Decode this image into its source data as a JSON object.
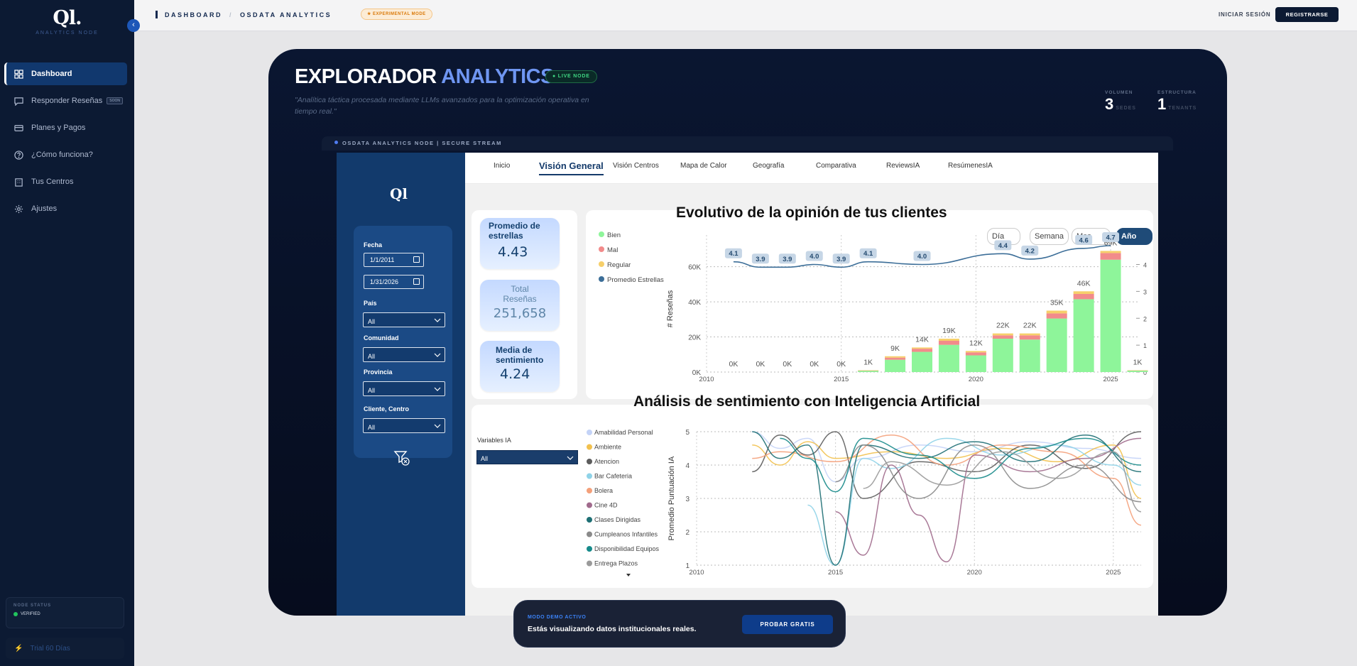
{
  "sidebar": {
    "logo_mark": "Ql.",
    "logo_sub": "ANALYTICS NODE",
    "collapse_icon": "chevron-left-icon",
    "items": [
      {
        "label": "Dashboard",
        "icon": "dashboard-icon",
        "active": true
      },
      {
        "label": "Responder Reseñas",
        "icon": "message-icon",
        "badge": "SOON"
      },
      {
        "label": "Planes y Pagos",
        "icon": "card-icon"
      },
      {
        "label": "¿Cómo funciona?",
        "icon": "help-icon"
      },
      {
        "label": "Tus Centros",
        "icon": "building-icon"
      },
      {
        "label": "Ajustes",
        "icon": "gear-icon"
      }
    ],
    "node_status": {
      "title": "NODE STATUS",
      "value": "VERIFIED"
    },
    "trial": "Trial 60 Días"
  },
  "topbar": {
    "crumb_1": "DASHBOARD",
    "crumb_sep": "/",
    "crumb_2": "OSDATA ANALYTICS",
    "experimental": "★ EXPERIMENTAL MODE",
    "login": "INICIAR SESIÓN",
    "register": "REGISTRARSE"
  },
  "hero": {
    "title_a": "EXPLORADOR",
    "title_b": "ANALYTICS",
    "live": "● LIVE NODE",
    "subtitle": "\"Analítica táctica procesada mediante LLMs avanzados para la optimización operativa en tiempo real.\"",
    "stats": [
      {
        "label": "VOLUMEN",
        "value": "3",
        "unit": "SEDES"
      },
      {
        "label": "ESTRUCTURA",
        "value": "1",
        "unit": "TENANTS"
      }
    ],
    "stream": "OSDATA ANALYTICS NODE | SECURE STREAM"
  },
  "report": {
    "logo": "Ql",
    "tabs": [
      "Inicio",
      "Visión General",
      "Visión Centros",
      "Mapa de Calor",
      "Geografía",
      "Comparativa",
      "ReviewsIA",
      "ResúmenesIA"
    ],
    "active_tab": "Visión General",
    "filters": {
      "fecha_label": "Fecha",
      "date_from": "1/1/2011",
      "date_to": "1/31/2026",
      "pais_label": "País",
      "pais_value": "All",
      "comunidad_label": "Comunidad",
      "comunidad_value": "All",
      "provincia_label": "Provincia",
      "provincia_value": "All",
      "cliente_label": "Cliente, Centro",
      "cliente_value": "All",
      "reset_icon": "filter-clear-icon"
    },
    "kpis": [
      {
        "label": "Promedio de estrellas",
        "value": "4.43"
      },
      {
        "label": "Total Reseñas",
        "value": "251,658"
      },
      {
        "label": "Media de sentimiento",
        "value": "4.24"
      }
    ],
    "granularity": [
      "Día",
      "Semana",
      "Mes",
      "Año"
    ],
    "granularity_selected": "Año",
    "chart1_title": "Evolutivo de la opinión de tus clientes",
    "chart2_title": "Análisis de sentimiento con Inteligencia Artificial",
    "variables_label": "Variables IA",
    "variables_value": "All"
  },
  "chart_data": [
    {
      "type": "bar",
      "title": "Evolutivo de la opinión de tus clientes",
      "ylabel": "# Reseñas",
      "xlabel": "",
      "legend": [
        "Bien",
        "Mal",
        "Regular",
        "Promedio Estrellas"
      ],
      "legend_position": "left",
      "colors": {
        "Bien": "#8ef59a",
        "Mal": "#f28b8b",
        "Regular": "#f6cf6a",
        "Promedio Estrellas": "#3c6e98"
      },
      "categories": [
        2011,
        2012,
        2013,
        2014,
        2015,
        2016,
        2017,
        2018,
        2019,
        2020,
        2021,
        2022,
        2023,
        2024,
        2025,
        2026
      ],
      "x_ticks": [
        2010,
        2015,
        2020,
        2025
      ],
      "y_ticks": [
        "0K",
        "20K",
        "40K",
        "60K"
      ],
      "y2_ticks": [
        "0",
        "1",
        "2",
        "3",
        "4"
      ],
      "ylim": [
        0,
        72000
      ],
      "y2lim": [
        0,
        4.7
      ],
      "series": [
        {
          "name": "Bien",
          "values": [
            0,
            0,
            0,
            0,
            0,
            800,
            7000,
            11500,
            15500,
            9500,
            19000,
            18500,
            30500,
            41500,
            64000,
            900
          ]
        },
        {
          "name": "Mal",
          "values": [
            0,
            0,
            0,
            0,
            0,
            100,
            1200,
            1800,
            2300,
            1700,
            1900,
            2400,
            2900,
            3000,
            3800,
            50
          ]
        },
        {
          "name": "Regular",
          "values": [
            0,
            0,
            0,
            0,
            0,
            100,
            800,
            700,
            1200,
            800,
            1100,
            1100,
            1600,
            1500,
            1200,
            50
          ]
        },
        {
          "name": "Promedio Estrellas",
          "axis": "secondary",
          "values": [
            4.1,
            3.9,
            3.9,
            4.0,
            3.9,
            4.1,
            null,
            4.0,
            null,
            null,
            4.4,
            4.2,
            null,
            4.6,
            4.7,
            null
          ]
        }
      ],
      "bar_labels": [
        "0K",
        "0K",
        "0K",
        "0K",
        "0K",
        "1K",
        "9K",
        "14K",
        "19K",
        "12K",
        "22K",
        "22K",
        "35K",
        "46K",
        "69K",
        "1K"
      ],
      "line_labels": [
        "4.1",
        "3.9",
        "3.9",
        "4.0",
        "3.9",
        "4.1",
        "",
        "4.0",
        "",
        "",
        "4.4",
        "4.2",
        "",
        "4.6",
        "4.7",
        ""
      ]
    },
    {
      "type": "line",
      "title": "Análisis de sentimiento con Inteligencia Artificial",
      "ylabel": "Promedio Puntuación IA",
      "xlabel": "",
      "x_ticks": [
        2010,
        2015,
        2020,
        2025
      ],
      "y_ticks": [
        1,
        2,
        3,
        4,
        5
      ],
      "ylim": [
        1,
        5
      ],
      "xlim": [
        2010,
        2026
      ],
      "legend": [
        {
          "name": "Amabilidad Personal",
          "color": "#c4d3f7"
        },
        {
          "name": "Ambiente",
          "color": "#f2c14e"
        },
        {
          "name": "Atencion",
          "color": "#5c5c5c"
        },
        {
          "name": "Bar Cafeteria",
          "color": "#8fd3e8"
        },
        {
          "name": "Bolera",
          "color": "#f4a07a"
        },
        {
          "name": "Cine 4D",
          "color": "#a06a8c"
        },
        {
          "name": "Clases Dirigidas",
          "color": "#1e6f74"
        },
        {
          "name": "Cumpleanos Infantiles",
          "color": "#8a8a8a"
        },
        {
          "name": "Disponibilidad Equipos",
          "color": "#178a8a"
        },
        {
          "name": "Entrega Plazos",
          "color": "#9a9a9a"
        }
      ],
      "series": [
        {
          "name": "Amabilidad Personal",
          "values": [
            [
              2012,
              5
            ],
            [
              2013,
              4.5
            ],
            [
              2014,
              4.8
            ],
            [
              2015,
              3.5
            ],
            [
              2016,
              4.2
            ],
            [
              2018,
              4.6
            ],
            [
              2020,
              4.4
            ],
            [
              2022,
              4.7
            ],
            [
              2024,
              4.5
            ],
            [
              2026,
              4.2
            ]
          ]
        },
        {
          "name": "Ambiente",
          "values": [
            [
              2012,
              4.6
            ],
            [
              2013,
              4.0
            ],
            [
              2014,
              4.7
            ],
            [
              2015,
              4.2
            ],
            [
              2017,
              4.4
            ],
            [
              2019,
              4.2
            ],
            [
              2021,
              4.5
            ],
            [
              2023,
              4.1
            ],
            [
              2025,
              4.6
            ],
            [
              2026,
              3.0
            ]
          ]
        },
        {
          "name": "Atencion",
          "values": [
            [
              2012,
              3.8
            ],
            [
              2013,
              4.9
            ],
            [
              2014,
              4.3
            ],
            [
              2015,
              5
            ],
            [
              2016,
              3.0
            ],
            [
              2018,
              4.1
            ],
            [
              2020,
              3.8
            ],
            [
              2022,
              4.6
            ],
            [
              2024,
              3.9
            ],
            [
              2026,
              5
            ]
          ]
        },
        {
          "name": "Bar Cafeteria",
          "values": [
            [
              2014,
              2.8
            ],
            [
              2015,
              1.0
            ],
            [
              2016,
              4.2
            ],
            [
              2017,
              3.9
            ],
            [
              2019,
              4.8
            ],
            [
              2021,
              4.3
            ],
            [
              2023,
              4.6
            ],
            [
              2025,
              4.0
            ],
            [
              2026,
              3.4
            ]
          ]
        },
        {
          "name": "Bolera",
          "values": [
            [
              2012,
              4.2
            ],
            [
              2013,
              4.4
            ],
            [
              2015,
              4.1
            ],
            [
              2017,
              4.9
            ],
            [
              2019,
              4.0
            ],
            [
              2021,
              4.6
            ],
            [
              2023,
              4.4
            ],
            [
              2025,
              3.6
            ],
            [
              2026,
              2.2
            ]
          ]
        },
        {
          "name": "Cine 4D",
          "values": [
            [
              2015,
              2.6
            ],
            [
              2016,
              1.3
            ],
            [
              2017,
              4.0
            ],
            [
              2018,
              2.5
            ],
            [
              2019,
              1.1
            ],
            [
              2020,
              4.3
            ],
            [
              2022,
              3.8
            ],
            [
              2024,
              4.2
            ],
            [
              2026,
              4.8
            ]
          ]
        },
        {
          "name": "Clases Dirigidas",
          "values": [
            [
              2012,
              5
            ],
            [
              2013,
              4.2
            ],
            [
              2014,
              4.6
            ],
            [
              2015,
              1.0
            ],
            [
              2016,
              4.6
            ],
            [
              2018,
              4.2
            ],
            [
              2020,
              4.7
            ],
            [
              2022,
              4.1
            ],
            [
              2024,
              4.9
            ],
            [
              2026,
              3.8
            ]
          ]
        },
        {
          "name": "Cumpleanos Infantiles",
          "values": [
            [
              2015,
              3.5
            ],
            [
              2016,
              4.6
            ],
            [
              2018,
              3.0
            ],
            [
              2020,
              4.6
            ],
            [
              2022,
              3.3
            ],
            [
              2024,
              4.0
            ],
            [
              2026,
              2.9
            ]
          ]
        },
        {
          "name": "Disponibilidad Equipos",
          "values": [
            [
              2013,
              4.8
            ],
            [
              2014,
              4.2
            ],
            [
              2015,
              3.2
            ],
            [
              2016,
              4.8
            ],
            [
              2018,
              4.3
            ],
            [
              2020,
              3.6
            ],
            [
              2022,
              4.5
            ],
            [
              2024,
              4.8
            ],
            [
              2026,
              4.0
            ]
          ]
        },
        {
          "name": "Entrega Plazos",
          "values": [
            [
              2016,
              3.3
            ],
            [
              2017,
              4.1
            ],
            [
              2019,
              3.4
            ],
            [
              2021,
              4.4
            ],
            [
              2023,
              3.6
            ],
            [
              2025,
              4.4
            ],
            [
              2026,
              2.6
            ]
          ]
        }
      ]
    }
  ],
  "demo_banner": {
    "title": "MODO DEMO ACTIVO",
    "text": "Estás visualizando datos institucionales reales.",
    "button": "PROBAR GRATIS"
  }
}
